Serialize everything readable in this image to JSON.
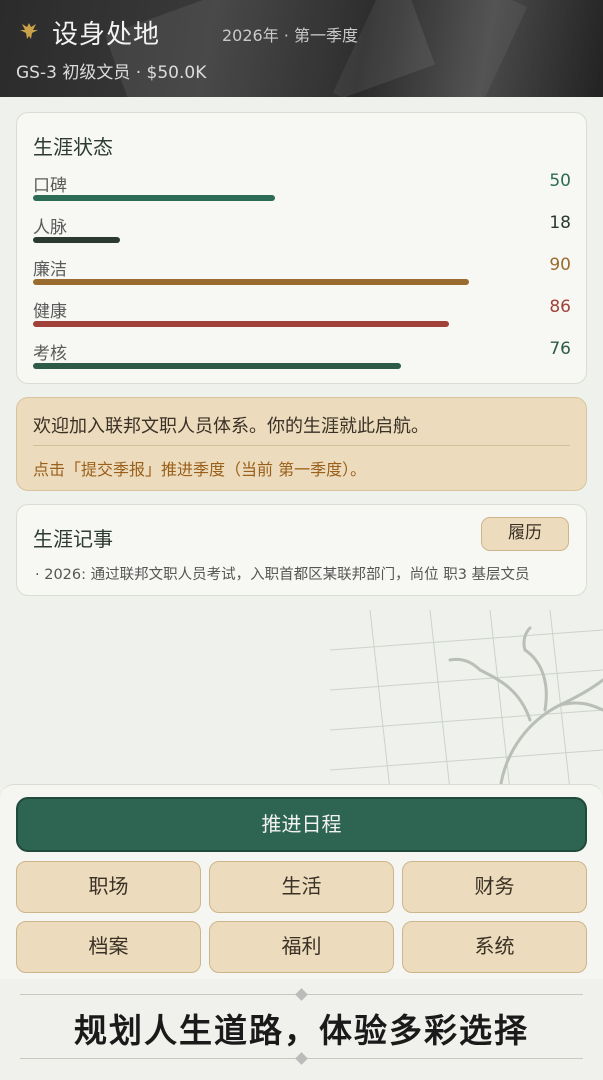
{
  "header": {
    "title": "设身处地",
    "date": "2026年 · 第一季度",
    "rank": "GS-3 初级文员 · $50.0K",
    "logo_icon": "golden-eagle-icon"
  },
  "status": {
    "title": "生涯状态",
    "stats": [
      {
        "label": "口碑",
        "value": 50,
        "color": "#2e6b56"
      },
      {
        "label": "人脉",
        "value": 18,
        "color": "#2a3a30"
      },
      {
        "label": "廉洁",
        "value": 90,
        "color": "#9a6b2e"
      },
      {
        "label": "健康",
        "value": 86,
        "color": "#a0413a"
      },
      {
        "label": "考核",
        "value": 76,
        "color": "#2e5a4a"
      }
    ]
  },
  "notice": {
    "main": "欢迎加入联邦文职人员体系。你的生涯就此启航。",
    "sub": "点击「提交季报」推进季度（当前 第一季度）。"
  },
  "events": {
    "title": "生涯记事",
    "resume_label": "履历",
    "items": [
      "· 2026: 通过联邦文职人员考试，入职首都区某联邦部门，尚位 职3 基层文员"
    ]
  },
  "actions": {
    "advance_label": "推进日程",
    "menu": [
      "职场",
      "生活",
      "财务",
      "档案",
      "福利",
      "系统"
    ]
  },
  "footer": {
    "slogan": "规划人生道路，体验多彩选择"
  }
}
